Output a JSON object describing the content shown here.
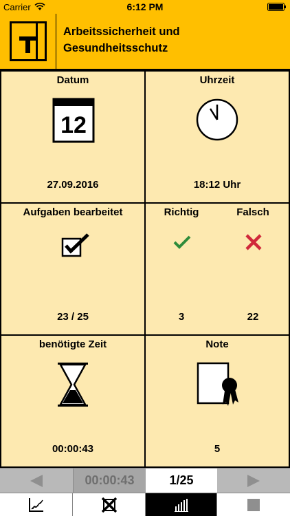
{
  "status_bar": {
    "carrier": "Carrier",
    "time": "6:12 PM",
    "icons": [
      "wifi-icon",
      "battery-icon"
    ]
  },
  "header": {
    "logo_letter": "T",
    "title_line1": "Arbeitssicherheit und",
    "title_line2": "Gesundheitsschutz"
  },
  "cells": {
    "datum": {
      "label": "Datum",
      "calendar_day": "12",
      "value": "27.09.2016",
      "icon": "calendar-icon"
    },
    "uhrzeit": {
      "label": "Uhrzeit",
      "value": "18:12 Uhr",
      "icon": "clock-icon"
    },
    "aufgaben": {
      "label": "Aufgaben bearbeitet",
      "value": "23 / 25",
      "icon": "checkbox-checked-icon"
    },
    "richtig": {
      "label": "Richtig",
      "value": "3",
      "icon": "check-icon"
    },
    "falsch": {
      "label": "Falsch",
      "value": "22",
      "icon": "cross-icon"
    },
    "zeit": {
      "label": "benötigte Zeit",
      "value": "00:00:43",
      "icon": "hourglass-icon"
    },
    "note": {
      "label": "Note",
      "value": "5",
      "icon": "certificate-icon"
    }
  },
  "nav": {
    "timer": "00:00:43",
    "page": "1/25",
    "icons": [
      "arrow-left-icon",
      "arrow-right-icon"
    ]
  },
  "tabs": [
    "statistics-icon",
    "checkbox-cross-icon",
    "bar-chart-icon",
    "stop-icon"
  ],
  "colors": {
    "brand": "#ffbf00",
    "cell_bg": "#fde9b0",
    "check": "#2e8b3a",
    "cross": "#d0283a"
  }
}
